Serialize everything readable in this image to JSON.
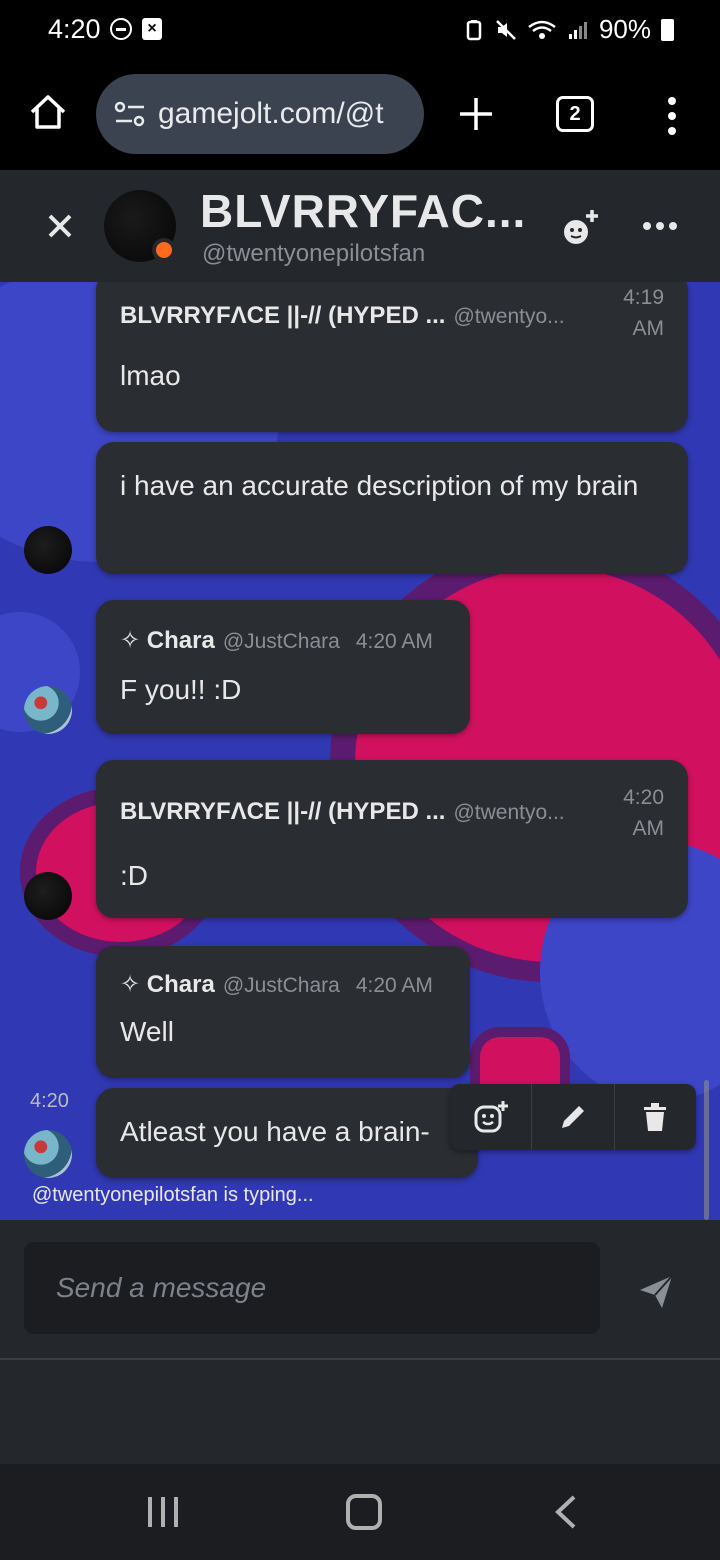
{
  "status_bar": {
    "time": "4:20",
    "battery": "90%",
    "icons": [
      "minus-circle-icon",
      "image-x-icon",
      "battery-saver-icon",
      "mute-icon",
      "wifi-icon",
      "signal-icon",
      "battery-icon"
    ]
  },
  "browser": {
    "url": "gamejolt.com/@t",
    "tab_count": "2"
  },
  "chat_header": {
    "title": "BLVRRYFAC...",
    "subtitle": "@twentyonepilotsfan",
    "online_status_color": "#ff6a1e"
  },
  "messages": [
    {
      "author": "BLVRRYFΛCE ||-// (HYPED ...",
      "handle": "@twentyo...",
      "time_line1": "4:19",
      "time_line2": "AM",
      "text": "lmao"
    },
    {
      "text": "i have an accurate description of my brain"
    },
    {
      "author": "Chara",
      "handle": "@JustChara",
      "time": "4:20 AM",
      "text": "F you!! :D"
    },
    {
      "author": "BLVRRYFΛCE ||-// (HYPED ...",
      "handle": "@twentyo...",
      "time_line1": "4:20",
      "time_line2": "AM",
      "text": ":D"
    },
    {
      "author": "Chara",
      "handle": "@JustChara",
      "time": "4:20 AM",
      "text": "Well"
    },
    {
      "side_time": "4:20",
      "text": "Atleast you have a brain-"
    }
  ],
  "message_actions": [
    "add-reaction-icon",
    "edit-icon",
    "delete-icon"
  ],
  "typing_indicator": "@twentyonepilotsfan is typing...",
  "composer": {
    "placeholder": "Send a message"
  },
  "colors": {
    "chat_bg": "#3138b3",
    "bubble": "#2a2d31",
    "header": "#24272b",
    "accent_pink": "#e0106a"
  }
}
